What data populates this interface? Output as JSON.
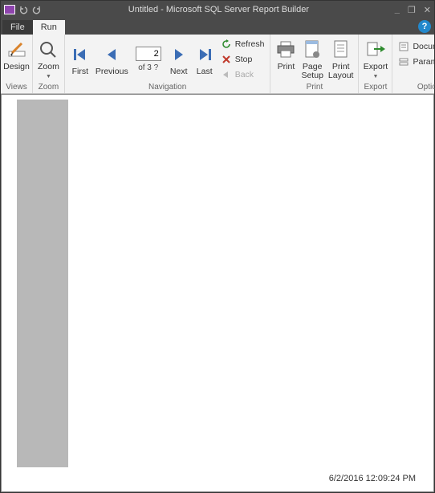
{
  "window": {
    "title": "Untitled - Microsoft SQL Server Report Builder",
    "min_tooltip": "Minimize",
    "restore_tooltip": "Restore",
    "close_tooltip": "Close"
  },
  "qat": {
    "undo": "Undo",
    "redo": "Redo"
  },
  "tabs": {
    "file": "File",
    "run": "Run",
    "help": "?"
  },
  "ribbon": {
    "views": {
      "label": "Views",
      "design": "Design"
    },
    "zoom": {
      "label": "Zoom",
      "btn": "Zoom"
    },
    "navigation": {
      "label": "Navigation",
      "first": "First",
      "previous": "Previous",
      "next": "Next",
      "last": "Last",
      "page_value": "2",
      "of_text": "of 3 ?",
      "refresh": "Refresh",
      "stop": "Stop",
      "back": "Back"
    },
    "print": {
      "label": "Print",
      "print": "Print",
      "page_setup": "Page\nSetup",
      "print_layout": "Print\nLayout"
    },
    "export": {
      "label": "Export",
      "btn": "Export"
    },
    "options": {
      "label": "Options",
      "document_map": "Document",
      "parameters": "Parameters"
    }
  },
  "status": {
    "timestamp": "6/2/2016 12:09:24 PM"
  }
}
